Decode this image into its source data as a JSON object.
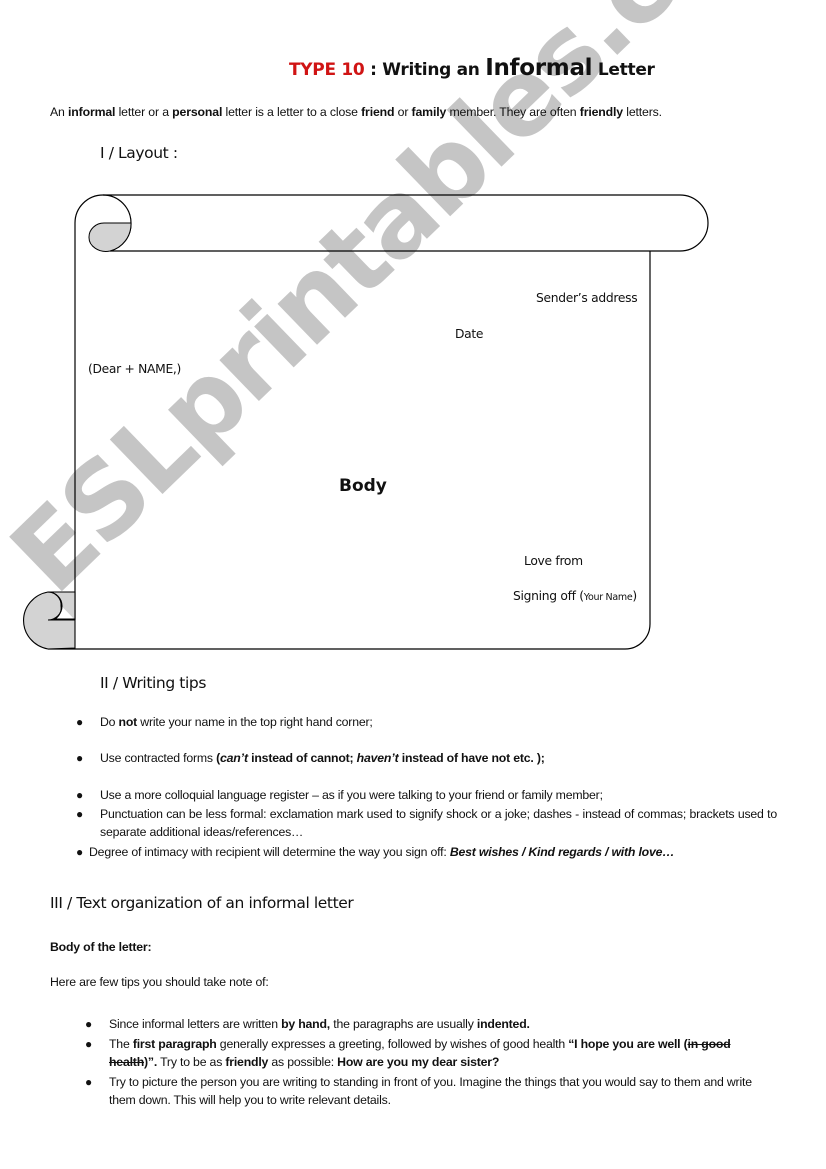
{
  "title": {
    "type_label": "TYPE 10",
    "part1": " : Writing an ",
    "emphasis": "Informal",
    "part2": " Letter",
    "accent_color": "#d01414"
  },
  "intro": {
    "segments": [
      {
        "t": "An ",
        "b": false
      },
      {
        "t": "informal",
        "b": true
      },
      {
        "t": " letter or a ",
        "b": false
      },
      {
        "t": "personal",
        "b": true
      },
      {
        "t": " letter is a letter to a close ",
        "b": false
      },
      {
        "t": "friend",
        "b": true
      },
      {
        "t": " or ",
        "b": false
      },
      {
        "t": "family",
        "b": true
      },
      {
        "t": " member. They are often ",
        "b": false
      },
      {
        "t": "friendly",
        "b": true
      },
      {
        "t": " letters.",
        "b": false
      }
    ]
  },
  "section1": {
    "heading": "I / Layout :"
  },
  "layout": {
    "senders_address": "Sender’s address",
    "date": "Date",
    "greeting": "(Dear + NAME,)",
    "body": "Body",
    "closing": "Love from",
    "signing_off": "Signing off (",
    "your_name": "Your Name",
    "signing_close": ")"
  },
  "section2": {
    "heading": "II / Writing tips",
    "tips": [
      {
        "parts": [
          {
            "t": "Do ",
            "s": "n"
          },
          {
            "t": "not",
            "s": "b"
          },
          {
            "t": " write your name in the top right hand corner;",
            "s": "n"
          }
        ]
      },
      {
        "parts": [
          {
            "t": "Use contracted forms ",
            "s": "n"
          },
          {
            "t": "(",
            "s": "b"
          },
          {
            "t": "can’t",
            "s": "bi"
          },
          {
            "t": " instead of cannot; ",
            "s": "b"
          },
          {
            "t": "haven’t",
            "s": "bi"
          },
          {
            "t": " instead of have not  etc. );",
            "s": "b"
          }
        ]
      },
      {
        "parts": [
          {
            "t": "Use a more colloquial language register – as if you were talking to your friend or family member;",
            "s": "n"
          }
        ]
      },
      {
        "parts": [
          {
            "t": "Punctuation can be less formal: exclamation mark used to signify shock or a joke; dashes - instead of commas; brackets used to separate additional ideas/references…",
            "s": "n"
          }
        ]
      },
      {
        "parts": [
          {
            "t": "Degree of intimacy with recipient will determine the way you sign off: ",
            "s": "n"
          },
          {
            "t": "Best wishes / Kind regards / with love…",
            "s": "bi"
          }
        ]
      }
    ]
  },
  "section3": {
    "heading": "III / Text organization of an informal letter",
    "subheading": "Body of the letter:",
    "lead": "Here are few tips you should take note of:",
    "tips": [
      {
        "parts": [
          {
            "t": "Since informal letters are written ",
            "s": "n"
          },
          {
            "t": "by hand,",
            "s": "b"
          },
          {
            "t": " the paragraphs are usually ",
            "s": "n"
          },
          {
            "t": "indented.",
            "s": "b"
          }
        ]
      },
      {
        "parts": [
          {
            "t": "The ",
            "s": "n"
          },
          {
            "t": "first paragraph",
            "s": "b"
          },
          {
            "t": " generally expresses a greeting, followed by wishes of good health ",
            "s": "n"
          },
          {
            "t": "“I hope you are well (",
            "s": "b"
          },
          {
            "t": "in good health",
            "s": "bs"
          },
          {
            "t": ")”.",
            "s": "b"
          },
          {
            "t": " Try to be as ",
            "s": "n"
          },
          {
            "t": "friendly",
            "s": "b"
          },
          {
            "t": " as possible: ",
            "s": "n"
          },
          {
            "t": "How are you my dear sister?",
            "s": "b"
          }
        ]
      },
      {
        "parts": [
          {
            "t": "Try to picture the person you are writing to standing in front of you. Imagine the things that you would say to them and write them down. This will help you to write relevant details.",
            "s": "n"
          }
        ]
      }
    ]
  },
  "watermark": {
    "text": "ESLprintables.com",
    "color": "#aaaaaa"
  }
}
